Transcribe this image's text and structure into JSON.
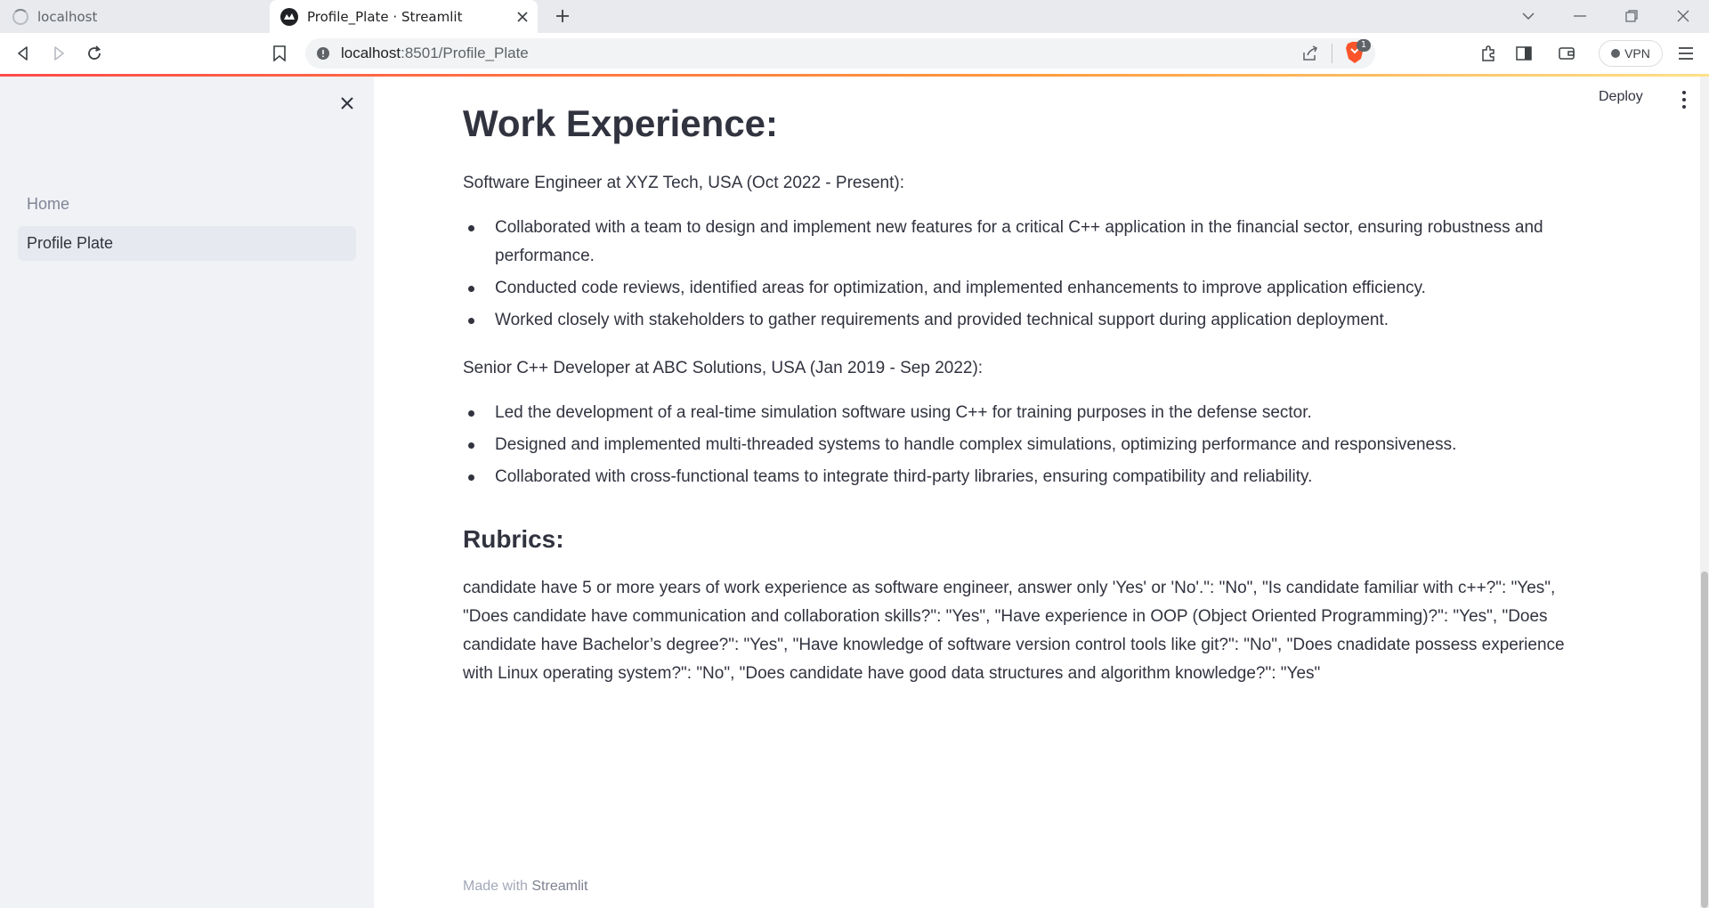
{
  "browser": {
    "tabs": [
      {
        "title": "localhost",
        "active": false
      },
      {
        "title": "Profile_Plate · Streamlit",
        "active": true
      }
    ],
    "url": {
      "host": "localhost",
      "rest": ":8501/Profile_Plate"
    },
    "brave_badge": "1",
    "vpn_label": "VPN"
  },
  "sidebar": {
    "items": [
      {
        "label": "Home",
        "selected": false
      },
      {
        "label": "Profile Plate",
        "selected": true
      }
    ]
  },
  "header": {
    "deploy_label": "Deploy"
  },
  "content": {
    "work_heading": "Work Experience:",
    "job1": {
      "title": "Software Engineer at XYZ Tech, USA (Oct 2022 - Present):",
      "bullets": [
        "Collaborated with a team to design and implement new features for a critical C++ application in the financial sector, ensuring robustness and performance.",
        "Conducted code reviews, identified areas for optimization, and implemented enhancements to improve application efficiency.",
        "Worked closely with stakeholders to gather requirements and provided technical support during application deployment."
      ]
    },
    "job2": {
      "title": "Senior C++ Developer at ABC Solutions, USA (Jan 2019 - Sep 2022):",
      "bullets": [
        "Led the development of a real-time simulation software using C++ for training purposes in the defense sector.",
        "Designed and implemented multi-threaded systems to handle complex simulations, optimizing performance and responsiveness.",
        "Collaborated with cross-functional teams to integrate third-party libraries, ensuring compatibility and reliability."
      ]
    },
    "rubrics_heading": "Rubrics:",
    "rubrics_text": "candidate have 5 or more years of work experience as software engineer, answer only 'Yes' or 'No'.\": \"No\", \"Is candidate familiar with c++?\": \"Yes\", \"Does candidate have communication and collaboration skills?\": \"Yes\", \"Have experience in OOP (Object Oriented Programming)?\": \"Yes\", \"Does candidate have Bachelor’s degree?\": \"Yes\", \"Have knowledge of software version control tools like git?\": \"No\", \"Does cnadidate possess experience with Linux operating system?\": \"No\", \"Does candidate have good data structures and algorithm knowledge?\": \"Yes\""
  },
  "footer": {
    "made_with": "Made with",
    "brand": "Streamlit"
  }
}
